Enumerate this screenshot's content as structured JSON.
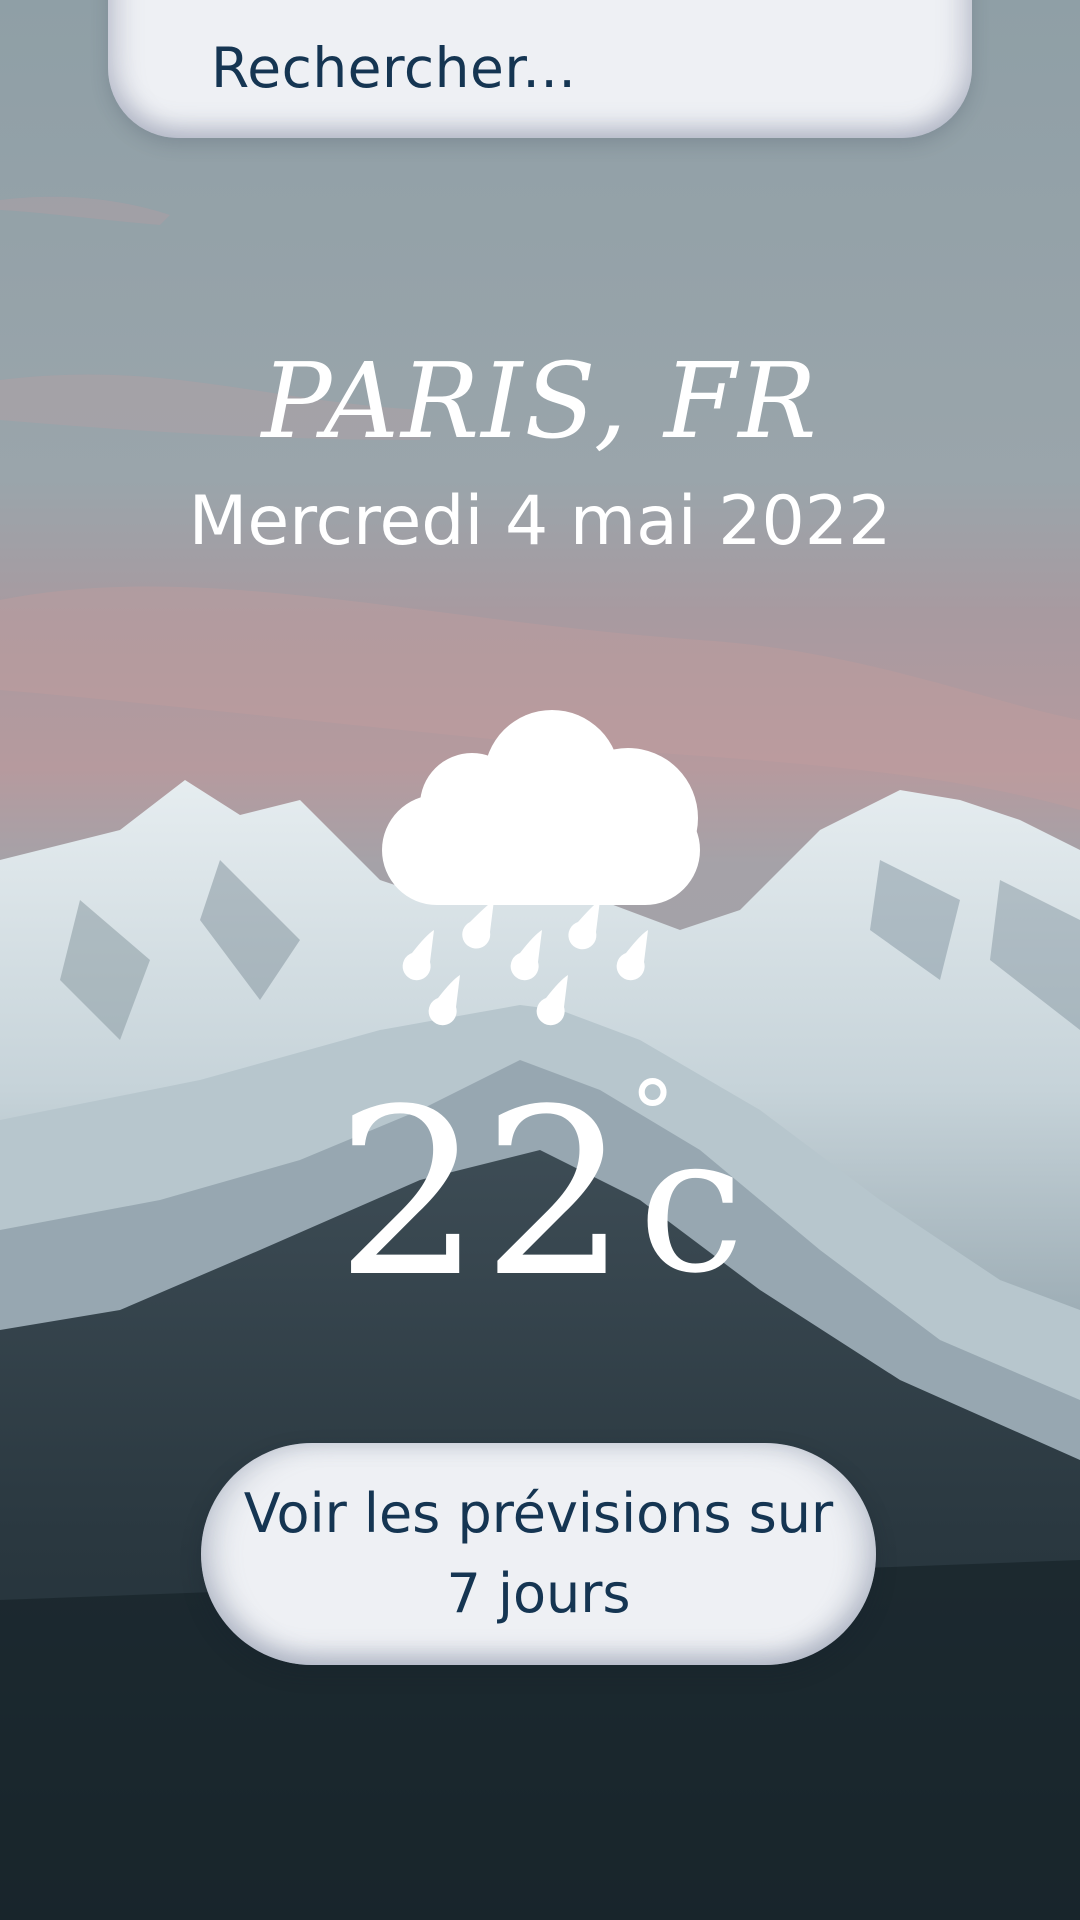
{
  "search": {
    "placeholder": "Rechercher..."
  },
  "location": {
    "city": "PARIS, FR"
  },
  "date": {
    "label": "Mercredi 4 mai 2022"
  },
  "weather": {
    "icon": "cloud-rain-icon",
    "temperature": "22",
    "unit_symbol": "°",
    "unit_letter": "c"
  },
  "forecast_button": {
    "label": "Voir les prévisions sur 7 jours"
  },
  "colors": {
    "accent_text": "#153552",
    "pill_background": "#eef0f4",
    "foreground": "#ffffff"
  }
}
